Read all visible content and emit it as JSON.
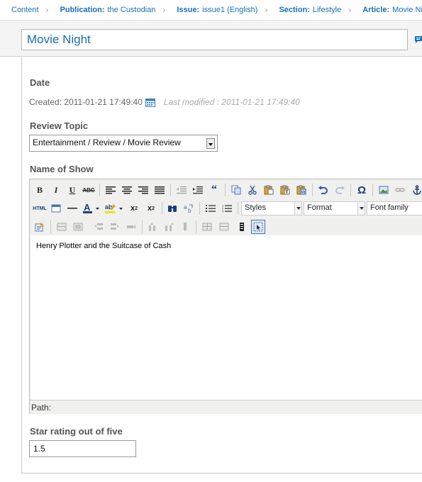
{
  "breadcrumb": [
    {
      "label": "",
      "value": "Content"
    },
    {
      "label": "Publication:",
      "value": "the Custodian"
    },
    {
      "label": "Issue:",
      "value": "issue1 (English)"
    },
    {
      "label": "Section:",
      "value": "Lifestyle"
    },
    {
      "label": "Article:",
      "value": "Movie Night (E"
    }
  ],
  "article": {
    "title": "Movie Night"
  },
  "date": {
    "label": "Date",
    "created": "Created: 2011-01-21 17:49:40",
    "last_modified": "Last modified : 2011-01-21 17:49:40"
  },
  "review_topic": {
    "label": "Review Topic",
    "selected": "Entertainment / Review / Movie Review"
  },
  "name_of_show": {
    "label": "Name of Show",
    "content": "Henry Plotter and the Suitcase of Cash",
    "path_label": "Path:",
    "toolbar": {
      "styles": "Styles",
      "format": "Format",
      "font_family": "Font family",
      "bold": "B",
      "italic": "I",
      "underline": "U",
      "strikethrough": "ABC",
      "html": "HTML"
    }
  },
  "star_rating": {
    "label": "Star rating out of five",
    "value": "1.5"
  },
  "colors": {
    "link": "#1a6fb3",
    "label": "#555555",
    "toolbar_bg": "#f0f0ee"
  }
}
